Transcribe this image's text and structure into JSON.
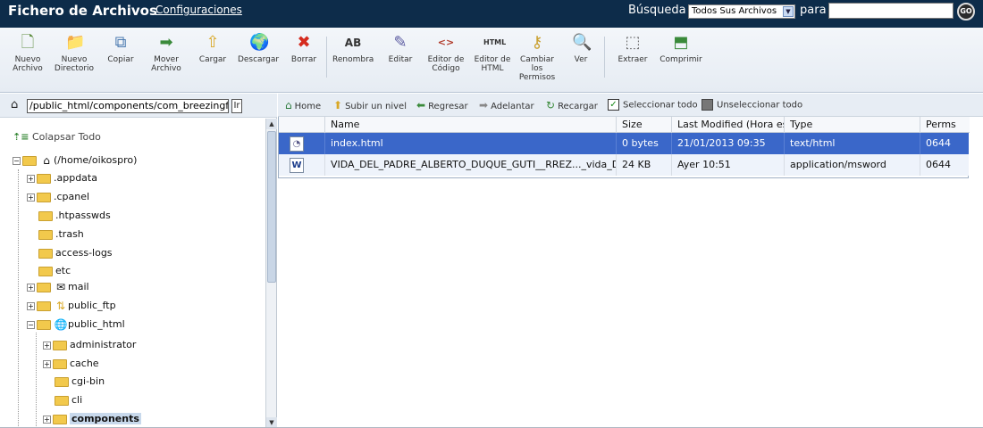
{
  "header": {
    "title": "Fichero de Archivos",
    "config_link": "Configuraciones",
    "search_label": "Búsqueda",
    "search_scope": "Todos Sus Archivos",
    "para_label": "para",
    "search_value": "",
    "go_label": "GO"
  },
  "toolbar": {
    "new_file": "Nuevo Archivo",
    "new_dir": "Nuevo Directorio",
    "copy": "Copiar",
    "move": "Mover Archivo",
    "upload": "Cargar",
    "download": "Descargar",
    "delete": "Borrar",
    "rename": "Renombra",
    "edit": "Editar",
    "code_editor": "Editor de Código",
    "html_editor": "Editor de HTML",
    "permissions": "Cambiar los Permisos",
    "view": "Ver",
    "extract": "Extraer",
    "compress": "Comprimir"
  },
  "left": {
    "path_value": "/public_html/components/com_breezingforms",
    "path_go": "Ir",
    "collapse_all": "Colapsar Todo",
    "tree": [
      {
        "label": "(/home/oikospro)"
      },
      {
        "label": ".appdata"
      },
      {
        "label": ".cpanel"
      },
      {
        "label": ".htpasswds"
      },
      {
        "label": ".trash"
      },
      {
        "label": "access-logs"
      },
      {
        "label": "etc"
      },
      {
        "label": "mail"
      },
      {
        "label": "public_ftp"
      },
      {
        "label": "public_html"
      },
      {
        "label": "administrator"
      },
      {
        "label": "cache"
      },
      {
        "label": "cgi-bin"
      },
      {
        "label": "cli"
      },
      {
        "label": "components"
      }
    ]
  },
  "nav": {
    "home": "Home",
    "up_level": "Subir un nivel",
    "back": "Regresar",
    "forward": "Adelantar",
    "reload": "Recargar",
    "select_all": "Seleccionar todo",
    "unselect_all": "Unseleccionar todo"
  },
  "grid": {
    "headers": {
      "name": "Name",
      "size": "Size",
      "modified": "Last Modified (Hora est.",
      "type": "Type",
      "perms": "Perms"
    },
    "rows": [
      {
        "name": "index.html",
        "size": "0 bytes",
        "modified": "21/01/2013 09:35",
        "type": "text/html",
        "perms": "0644",
        "icon": "html-file-icon"
      },
      {
        "name": "VIDA_DEL_PADRE_ALBERTO_DUQUE_GUTI__RREZ..._vida_Dio",
        "size": "24 KB",
        "modified": "Ayer 10:51",
        "type": "application/msword",
        "perms": "0644",
        "icon": "word-file-icon"
      }
    ]
  }
}
